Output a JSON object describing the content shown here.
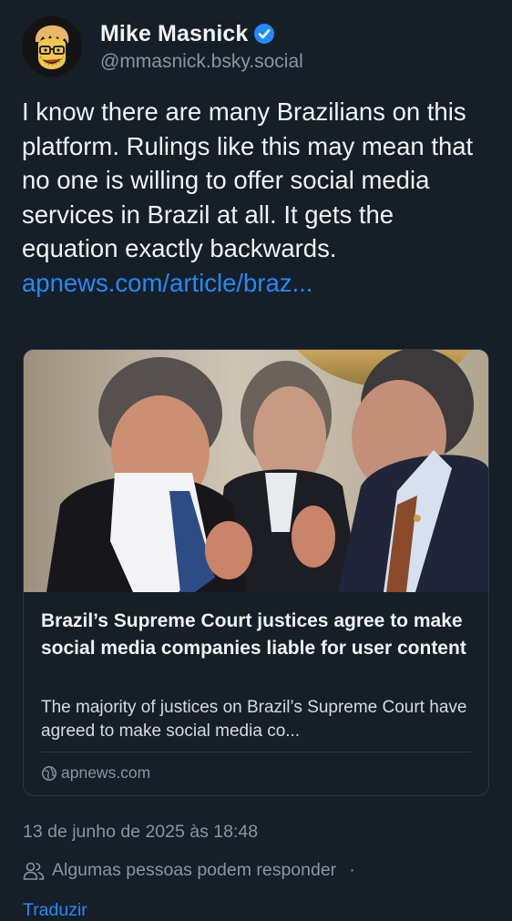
{
  "author": {
    "display_name": "Mike Masnick",
    "handle": "@mmasnick.bsky.social",
    "verified_icon": "verified-badge-icon"
  },
  "post": {
    "text": "I know there are many Brazilians on this platform. Rulings like this may mean that no one is willing to offer social media services in Brazil at all. It gets the equation exactly backwards. ",
    "link_text": "apnews.com/article/braz..."
  },
  "link_card": {
    "title": "Brazil’s Supreme Court justices agree to make social media companies liable for user content",
    "description": "The majority of justices on Brazil’s Supreme Court have agreed to make social media co...",
    "domain": "apnews.com",
    "globe_icon": "globe-icon"
  },
  "meta": {
    "timestamp": "13 de junho de 2025 às 18:48",
    "reply_setting": "Algumas pessoas podem responder",
    "separator": "·",
    "translate": "Traduzir",
    "reply_icon": "people-icon"
  },
  "colors": {
    "background": "#161e27",
    "link": "#208bfe",
    "muted": "#8795a5",
    "text": "#f1f3f5",
    "verified": "#208bfe"
  }
}
